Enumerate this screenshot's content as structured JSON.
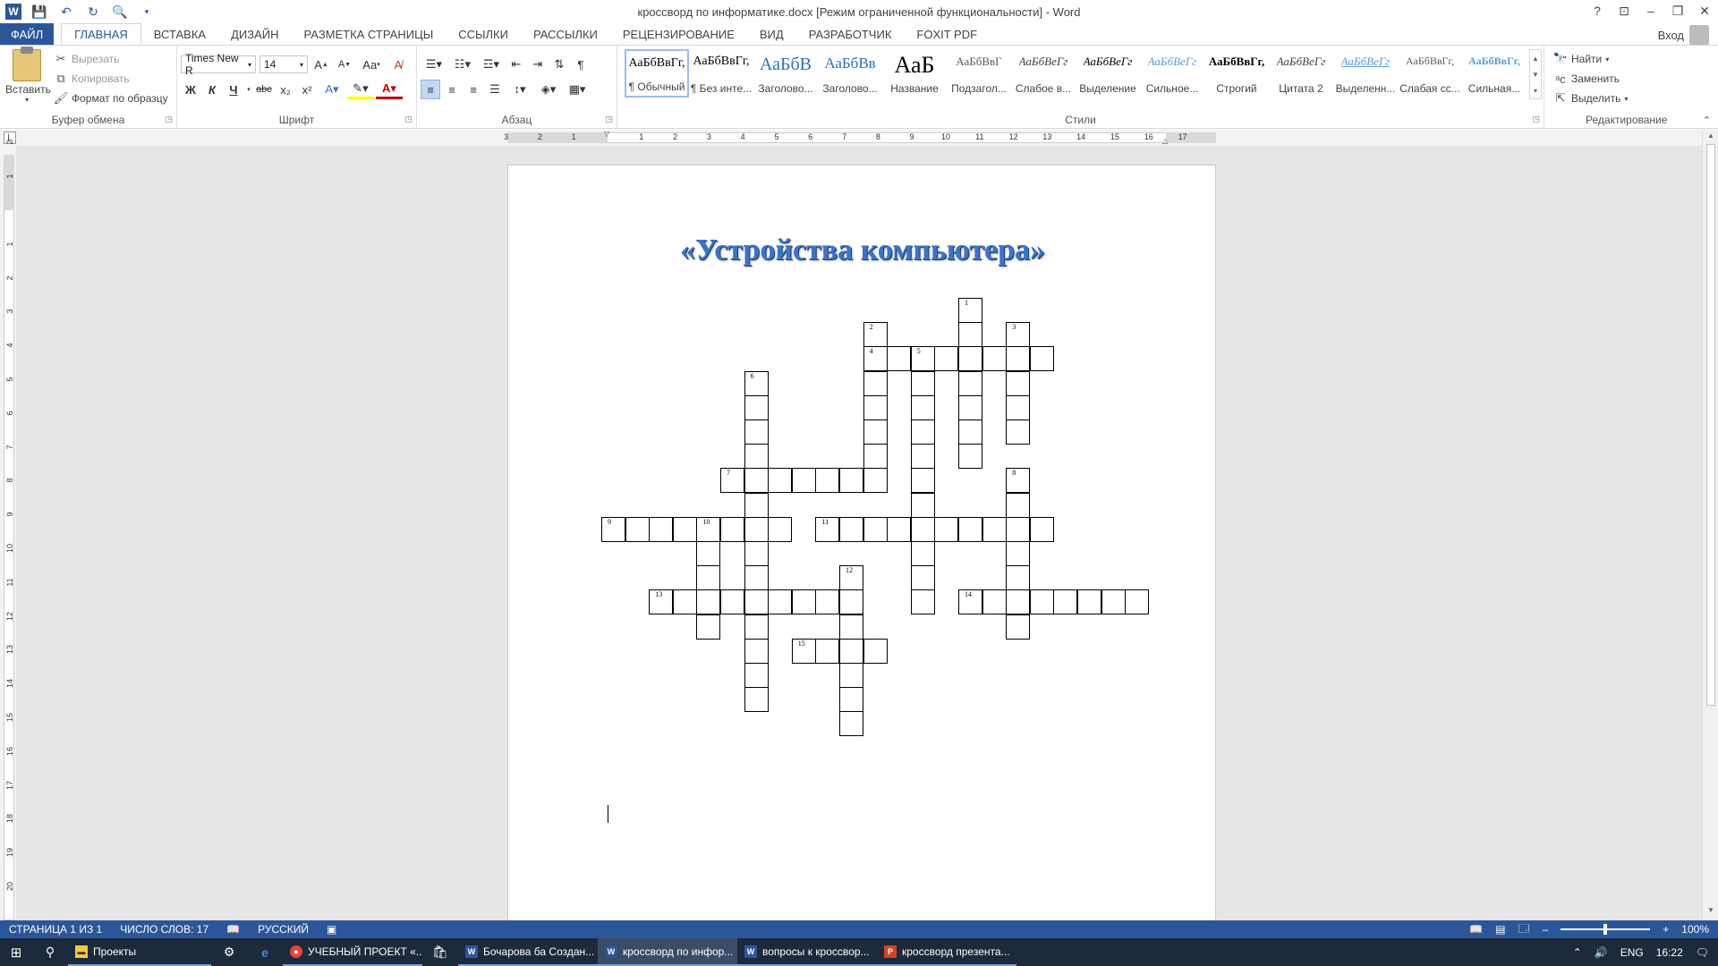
{
  "titlebar": {
    "title": "кроссворд по информатике.docx [Режим ограниченной функциональности] - Word",
    "help": "?",
    "minimize": "–",
    "restore": "❐",
    "close": "✕"
  },
  "tabs": [
    {
      "label": "ФАЙЛ"
    },
    {
      "label": "ГЛАВНАЯ"
    },
    {
      "label": "ВСТАВКА"
    },
    {
      "label": "ДИЗАЙН"
    },
    {
      "label": "РАЗМЕТКА СТРАНИЦЫ"
    },
    {
      "label": "ССЫЛКИ"
    },
    {
      "label": "РАССЫЛКИ"
    },
    {
      "label": "РЕЦЕНЗИРОВАНИЕ"
    },
    {
      "label": "ВИД"
    },
    {
      "label": "РАЗРАБОТЧИК"
    },
    {
      "label": "FOXIT PDF"
    }
  ],
  "signin": "Вход",
  "clipboard": {
    "paste": "Вставить",
    "cut": "Вырезать",
    "copy": "Копировать",
    "format_painter": "Формат по образцу",
    "label": "Буфер обмена"
  },
  "font": {
    "name": "Times New R",
    "size": "14",
    "case": "Aa",
    "bold": "Ж",
    "italic": "К",
    "underline": "Ч",
    "strike": "abc",
    "subscript": "x₂",
    "superscript": "x²",
    "label": "Шрифт"
  },
  "paragraph": {
    "label": "Абзац"
  },
  "styles": {
    "label": "Стили",
    "items": [
      {
        "preview": "АаБбВвГг,",
        "name": "¶ Обычный"
      },
      {
        "preview": "АаБбВвГг,",
        "name": "¶ Без инте..."
      },
      {
        "preview": "АаБбВ",
        "name": "Заголово..."
      },
      {
        "preview": "АаБбВв",
        "name": "Заголово..."
      },
      {
        "preview": "АаБ",
        "name": "Название"
      },
      {
        "preview": "АаБбВвГ",
        "name": "Подзагол..."
      },
      {
        "preview": "АаБбВеГг",
        "name": "Слабое в..."
      },
      {
        "preview": "АаБбВеГг",
        "name": "Выделение"
      },
      {
        "preview": "АаБбВеГг",
        "name": "Сильное..."
      },
      {
        "preview": "АаБбВвГг,",
        "name": "Строгий"
      },
      {
        "preview": "АаБбВеГг",
        "name": "Цитата 2"
      },
      {
        "preview": "АаБбВеГг",
        "name": "Выделенн..."
      },
      {
        "preview": "АаБбВвГг,",
        "name": "Слабая сс..."
      },
      {
        "preview": "АаБбВвГг,",
        "name": "Сильная..."
      }
    ]
  },
  "editing": {
    "find": "Найти",
    "replace": "Заменить",
    "select": "Выделить",
    "label": "Редактирование"
  },
  "ruler": {
    "h_labels": [
      "3",
      "2",
      "1",
      "1",
      "2",
      "3",
      "4",
      "5",
      "6",
      "7",
      "8",
      "9",
      "10",
      "11",
      "12",
      "13",
      "14",
      "15",
      "16",
      "17"
    ],
    "v_labels": [
      "2",
      "1",
      "1",
      "2",
      "3",
      "4",
      "5",
      "6",
      "7",
      "8",
      "9",
      "10",
      "11",
      "12",
      "13",
      "14",
      "15",
      "16",
      "17",
      "18",
      "19",
      "20"
    ]
  },
  "document": {
    "title": "«Устройства компьютера»",
    "clue_numbers": [
      "1",
      "2",
      "3",
      "4",
      "5",
      "6",
      "7",
      "8",
      "9",
      "10",
      "11",
      "12",
      "13",
      "14",
      "15"
    ]
  },
  "statusbar": {
    "page": "СТРАНИЦА 1 ИЗ 1",
    "words": "ЧИСЛО СЛОВ: 17",
    "language": "РУССКИЙ",
    "zoom": "100%"
  },
  "taskbar": {
    "items": [
      {
        "label": "Проекты"
      },
      {
        "label": "УЧЕБНЫЙ ПРОЕКТ «..."
      },
      {
        "label": "Бочарова ба Создан..."
      },
      {
        "label": "кроссворд по инфор..."
      },
      {
        "label": "вопросы к кроссвор..."
      },
      {
        "label": "кроссворд презента..."
      }
    ],
    "lang": "ENG",
    "time": "16:22"
  },
  "colors": {
    "accent": "#2b579a",
    "title_blue": "#3e74c4",
    "taskbar": "#1c2a3c"
  }
}
